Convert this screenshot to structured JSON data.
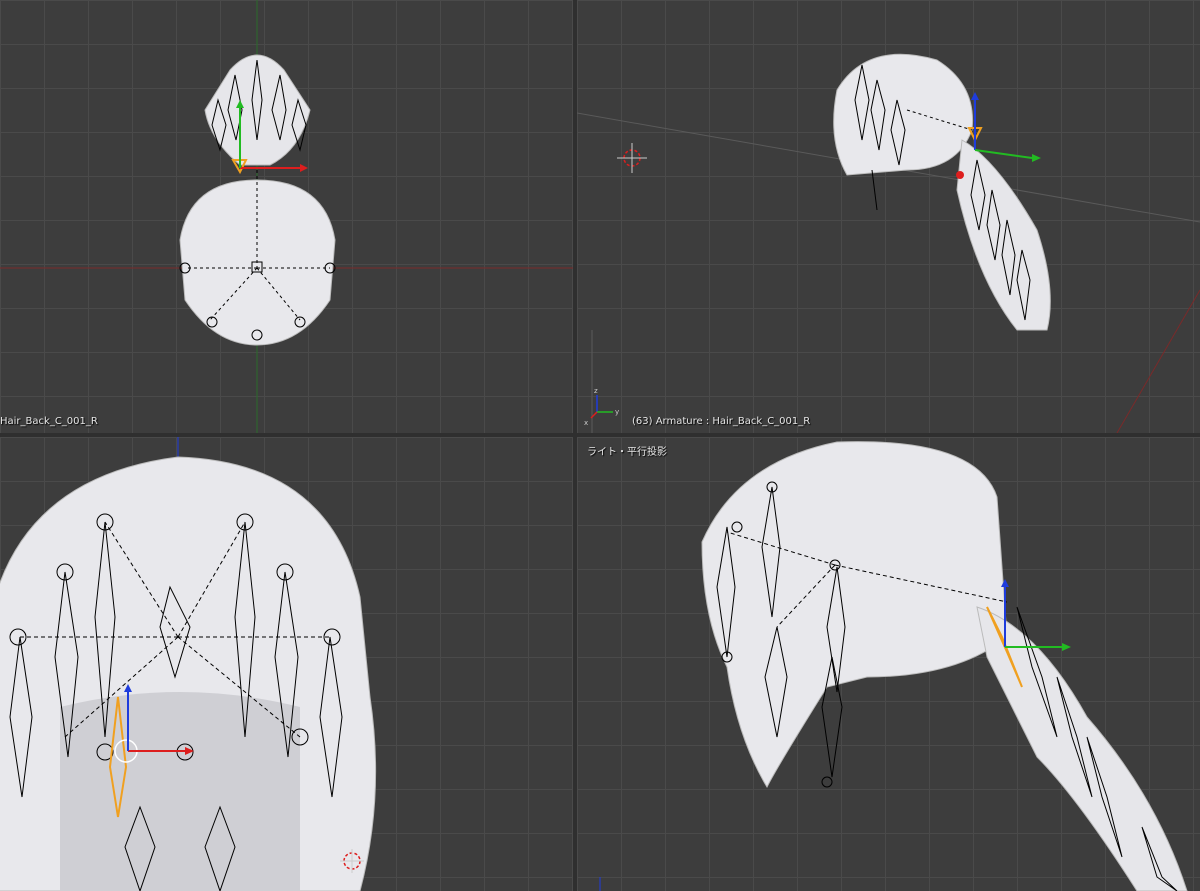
{
  "viewports": {
    "top_left": {
      "view": "front orthographic",
      "label": "Hair_Back_C_001_R"
    },
    "top_right": {
      "view": "user perspective",
      "label": "(63) Armature : Hair_Back_C_001_R",
      "axes": {
        "x": "x",
        "y": "y",
        "z": "z"
      }
    },
    "bottom_left": {
      "view": "back close-up"
    },
    "bottom_right": {
      "view": "side close-up",
      "header": "ライト・平行投影"
    }
  },
  "colors": {
    "viewport_bg": "#3d3d3d",
    "grid_line": "#4a4a4a",
    "hair": "#e8e8ec",
    "bone_outline": "#000000",
    "selected_bone": "#f0a020",
    "axis_x": "#dd1e1e",
    "axis_y": "#22bb22",
    "axis_z": "#1e3cdd"
  },
  "icons": [
    "3d-cursor-icon",
    "transform-gizmo-icon",
    "axis-indicator-icon"
  ]
}
